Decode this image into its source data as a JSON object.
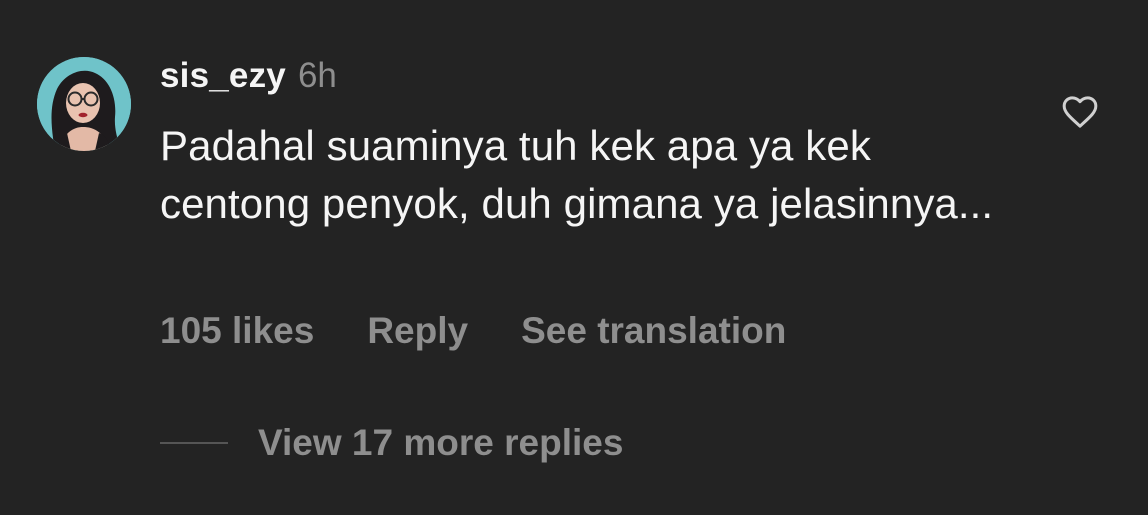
{
  "comment": {
    "username": "sis_ezy",
    "timestamp": "6h",
    "text": "Padahal suaminya tuh kek apa ya kek centong penyok, duh gimana ya jelasinnya...",
    "likes_label": "105 likes",
    "reply_label": "Reply",
    "translate_label": "See translation",
    "view_replies_label": "View 17 more replies",
    "avatar_icon": "user-avatar",
    "like_icon": "heart-outline-icon"
  },
  "colors": {
    "background": "#232323",
    "primary_text": "#f5f5f5",
    "secondary_text": "#8e8e8e",
    "avatar_bg": "#6fc3c9"
  }
}
